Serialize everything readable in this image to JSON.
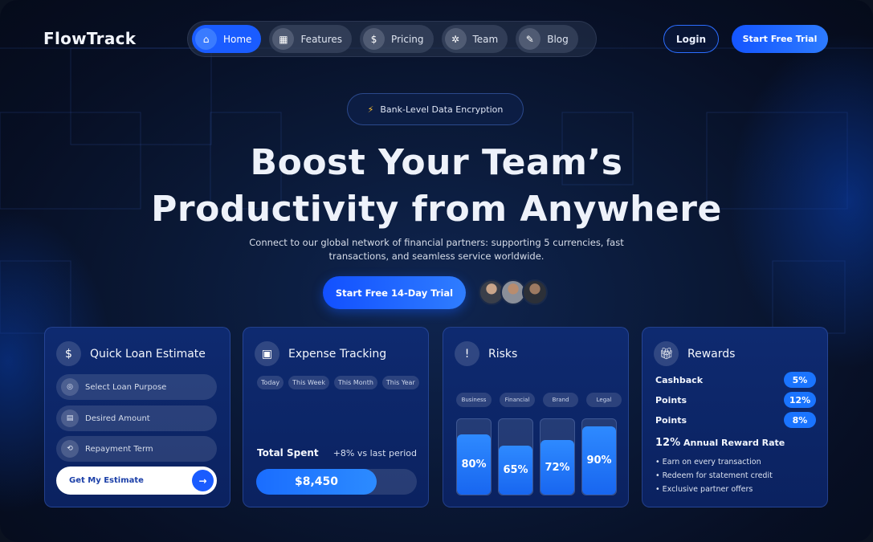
{
  "brand": {
    "logo": "FlowTrack"
  },
  "nav": {
    "items": [
      {
        "label": "Home",
        "icon": "home-icon",
        "glyph": "⌂"
      },
      {
        "label": "Features",
        "icon": "grid-icon",
        "glyph": "▦"
      },
      {
        "label": "Pricing",
        "icon": "tag-icon",
        "glyph": "$"
      },
      {
        "label": "Team",
        "icon": "team-icon",
        "glyph": "✲"
      },
      {
        "label": "Blog",
        "icon": "blog-icon",
        "glyph": "✎"
      }
    ],
    "active": "Home"
  },
  "header": {
    "login": "Login",
    "trial": "Start Free Trial"
  },
  "hero": {
    "badge": "Bank-Level Data Encryption",
    "title_line1": "Boost Your Team’s",
    "title_line2": "Productivity from Anywhere",
    "subtitle": "Connect to our global network of financial partners: supporting 5 currencies, fast transactions, and seamless service worldwide.",
    "cta": "Start Free 14-Day Trial"
  },
  "loan": {
    "title": "Quick Loan Estimate",
    "fields": [
      {
        "placeholder": "Select Loan Purpose",
        "icon": "purpose-icon"
      },
      {
        "placeholder": "Desired Amount",
        "icon": "money-icon"
      },
      {
        "placeholder": "Repayment Term",
        "icon": "term-icon"
      }
    ],
    "button": "Get My Estimate"
  },
  "expense": {
    "title": "Expense Tracking",
    "periods": [
      "Today",
      "This Week",
      "This Month",
      "This Year"
    ],
    "total_label": "Total Spent",
    "delta": "+8% vs last period",
    "amount": "$8,450",
    "fill_fraction": 0.75
  },
  "risks": {
    "title": "Risks",
    "categories": [
      "Business",
      "Financial",
      "Brand",
      "Legal"
    ],
    "values": [
      80,
      65,
      72,
      90
    ],
    "labels": [
      "80%",
      "65%",
      "72%",
      "90%"
    ]
  },
  "rewards": {
    "title": "Rewards",
    "rows": [
      {
        "name": "Cashback",
        "value": "5%"
      },
      {
        "name": "Points",
        "value": "12%"
      },
      {
        "name": "Points",
        "value": "8%"
      }
    ],
    "rate_value": "12%",
    "rate_label": "Annual Reward Rate",
    "benefits": [
      "Earn on every transaction",
      "Redeem for statement credit",
      "Exclusive partner offers"
    ]
  },
  "colors": {
    "accent": "#1a5cff",
    "card": "#0e2a70",
    "background": "#070f24"
  }
}
